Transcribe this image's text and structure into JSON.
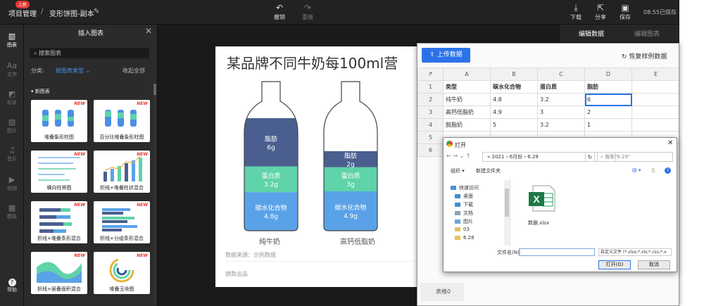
{
  "topbar": {
    "breadcrumb_root": "项目管理",
    "breadcrumb_sep": "/",
    "document_title": "变形饼图-副本",
    "undo": "撤销",
    "redo": "重做",
    "download": "下载",
    "share": "分享",
    "save": "保存",
    "save_time": "08:55已保存"
  },
  "rail": {
    "badge": "上新",
    "items": [
      "图表",
      "文字",
      "形状",
      "图片",
      "音乐",
      "视频",
      "模板"
    ],
    "help": "帮助"
  },
  "chart_panel": {
    "title": "插入图表",
    "search_placeholder": "搜索图表",
    "filter_label": "分类:",
    "filter_value": "按图表类型",
    "collapse_all": "收起全部",
    "section": "新图表",
    "new_tag": "NEW",
    "cards": [
      "堆叠象形柱图",
      "百分比堆叠象形柱图",
      "横向柱将图",
      "折线+堆叠柱状混合",
      "折线+堆叠条形混合",
      "折线+分组条形混合",
      "折线+层叠面积混合",
      "堆叠玉块图"
    ]
  },
  "canvas": {
    "title": "某品牌不同牛奶每100ml营",
    "source": "数据来源：示例数据",
    "brand": "镝数出品"
  },
  "chart_data": {
    "type": "bar",
    "title": "某品牌不同牛奶每100ml营",
    "categories": [
      "纯牛奶",
      "高钙低脂奶"
    ],
    "series": [
      {
        "name": "碳水化合物",
        "values": [
          4.8,
          4.9
        ],
        "labels": [
          "4.8g",
          "4.9g"
        ],
        "color": "#5aa2e8"
      },
      {
        "name": "蛋白质",
        "values": [
          3.2,
          3
        ],
        "labels": [
          "3.2g",
          "3g"
        ],
        "color": "#5fd3a9"
      },
      {
        "name": "脂肪",
        "values": [
          6,
          2
        ],
        "labels": [
          "6g",
          "2g"
        ],
        "color": "#4a5f8f"
      }
    ]
  },
  "right_tabs": {
    "edit_data": "编辑数据",
    "edit_chart": "编辑图表"
  },
  "editor": {
    "upload": "上传数据",
    "restore": "恢复样例数据",
    "columns": [
      "A",
      "B",
      "C",
      "D",
      "E"
    ],
    "rows": [
      [
        "类型",
        "碳水化合物",
        "蛋白质",
        "脂肪",
        ""
      ],
      [
        "纯牛奶",
        "4.8",
        "3.2",
        "6",
        ""
      ],
      [
        "高钙低脂奶",
        "4.9",
        "3",
        "2",
        ""
      ],
      [
        "脱脂奶",
        "5",
        "3.2",
        "1",
        ""
      ],
      [
        "",
        "",
        "",
        "",
        ""
      ],
      [
        "",
        "",
        "",
        "",
        ""
      ]
    ],
    "row_numbers": [
      "1",
      "2",
      "3",
      "4",
      "5",
      "6"
    ],
    "sheet": "表格0"
  },
  "dialog": {
    "title": "打开",
    "path": "« 2021 › 6月份 › 6.29",
    "refresh": "↻",
    "search_placeholder": "搜索\"6.29\"",
    "organize": "组织 ▾",
    "new_folder": "新建文件夹",
    "sidebar": [
      "快速访问",
      "桌面",
      "下载",
      "文档",
      "图片",
      "03",
      "6.28"
    ],
    "file_name": "数据.xlsx",
    "filename_label": "文件名(N):",
    "filetype": "自定义文件 (*.xlsx;*.xls;*.csv;*.x",
    "open": "打开(O)",
    "cancel": "取消"
  }
}
